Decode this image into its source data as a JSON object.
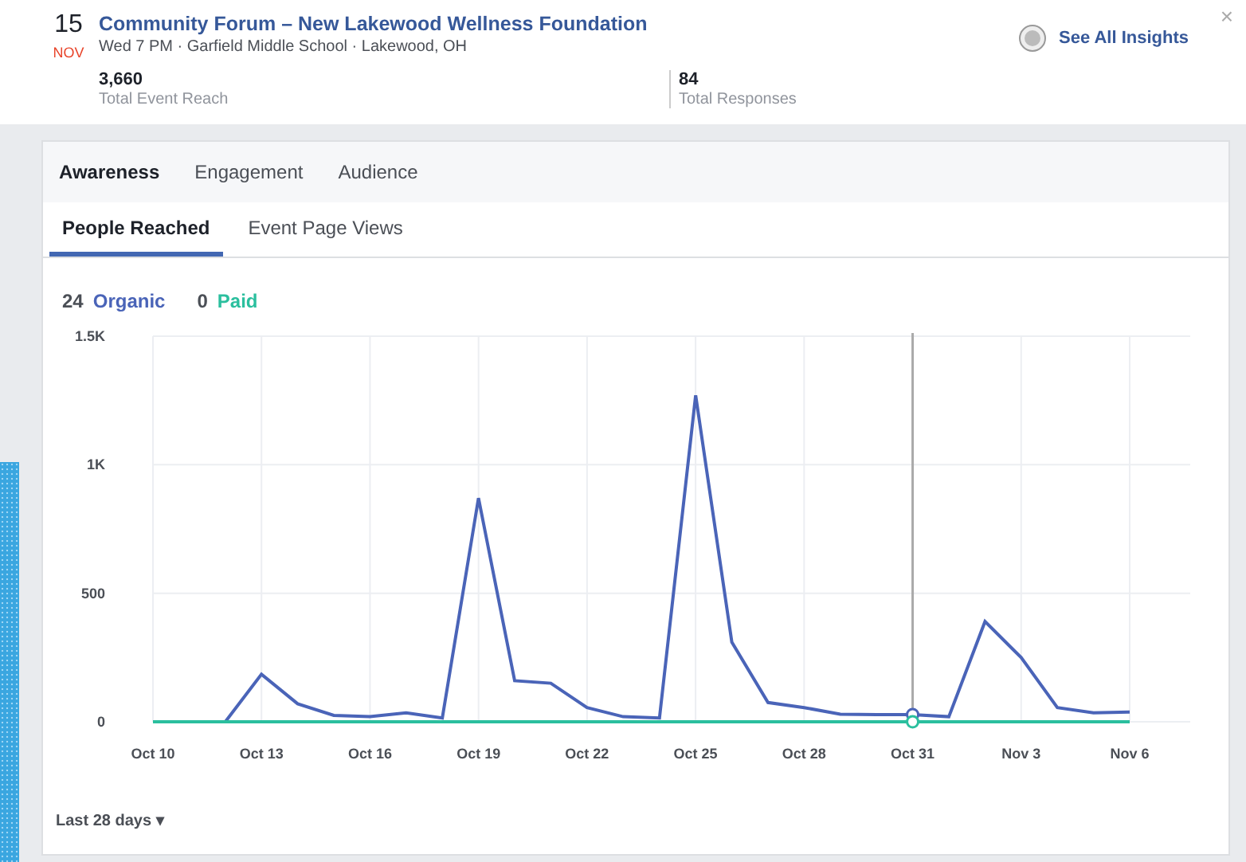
{
  "event": {
    "day": "15",
    "month": "NOV",
    "title": "Community Forum – New Lakewood Wellness Foundation",
    "details": "Wed 7 PM · Garfield Middle School · Lakewood, OH",
    "close": "×",
    "insights_link": "See All Insights"
  },
  "stats": [
    {
      "value": "3,660",
      "label": "Total Event Reach"
    },
    {
      "value": "84",
      "label": "Total Responses"
    }
  ],
  "tabs": [
    {
      "label": "Awareness",
      "selected": true
    },
    {
      "label": "Engagement",
      "selected": false
    },
    {
      "label": "Audience",
      "selected": false
    }
  ],
  "subtabs": [
    {
      "label": "People Reached",
      "selected": true
    },
    {
      "label": "Event Page Views",
      "selected": false
    }
  ],
  "legend": [
    {
      "count": "24"
    },
    {
      "count": "0"
    }
  ],
  "chart_data": {
    "type": "line",
    "categories": [
      "Oct 10",
      null,
      null,
      "Oct 13",
      null,
      null,
      "Oct 16",
      null,
      null,
      "Oct 19",
      null,
      null,
      "Oct 22",
      null,
      null,
      "Oct 25",
      null,
      null,
      "Oct 28",
      null,
      null,
      "Oct 31",
      null,
      null,
      "Nov 3",
      null,
      null,
      "Nov 6"
    ],
    "series": [
      {
        "name": "Organic",
        "color": "#4a64b8",
        "values": [
          0,
          0,
          0,
          185,
          70,
          25,
          20,
          35,
          15,
          870,
          160,
          150,
          55,
          20,
          15,
          1270,
          310,
          75,
          55,
          30,
          28,
          28,
          20,
          390,
          250,
          55,
          35,
          38
        ]
      },
      {
        "name": "Paid",
        "color": "#2bbf9e",
        "values": [
          0,
          0,
          0,
          0,
          0,
          0,
          0,
          0,
          0,
          0,
          0,
          0,
          0,
          0,
          0,
          0,
          0,
          0,
          0,
          0,
          0,
          0,
          0,
          0,
          0,
          0,
          0,
          0
        ]
      }
    ],
    "ylim": [
      0,
      1500
    ],
    "yticks": [
      0,
      {
        "value": 500,
        "label": "500"
      },
      {
        "value": 1000,
        "label": "1K"
      },
      {
        "value": 1500,
        "label": "1.5K"
      }
    ],
    "grid": true,
    "annotations": [
      {
        "x": "Oct 31"
      }
    ]
  },
  "range_menu": "Last 28 days ▾"
}
